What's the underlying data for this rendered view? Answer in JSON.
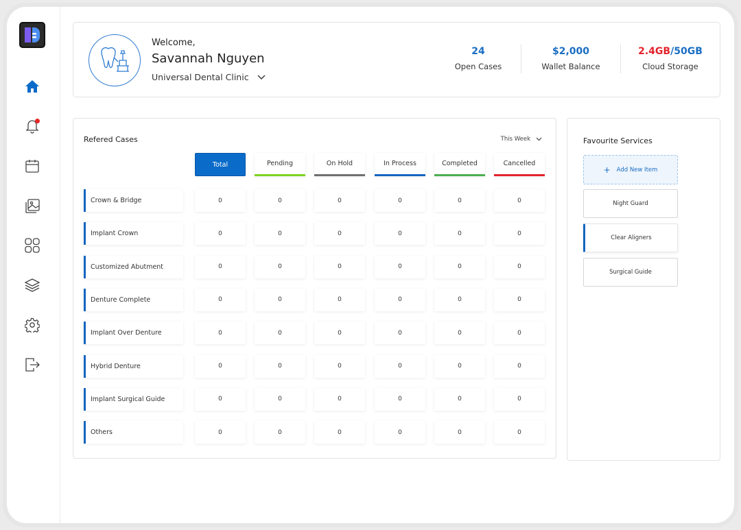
{
  "sidebar": {
    "icons": [
      "home-icon",
      "bell-icon",
      "calendar-icon",
      "gallery-icon",
      "grid-icon",
      "layers-icon",
      "settings-icon",
      "logout-icon"
    ]
  },
  "header": {
    "welcome": "Welcome,",
    "user_name": "Savannah Nguyen",
    "clinic": "Universal Dental Clinic",
    "stats": {
      "open_cases": {
        "value": "24",
        "label": "Open Cases"
      },
      "wallet": {
        "value": "$2,000",
        "label": "Wallet Balance"
      },
      "storage": {
        "used": "2.4GB",
        "separator": "/",
        "total": "50GB",
        "label": "Cloud Storage"
      }
    }
  },
  "cases": {
    "title": "Refered Cases",
    "period": "This Week",
    "tabs": [
      {
        "label": "Total",
        "color": "#0b6bc9"
      },
      {
        "label": "Pending",
        "color": "#7ed321"
      },
      {
        "label": "On Hold",
        "color": "#707070"
      },
      {
        "label": "In Process",
        "color": "#1565c0"
      },
      {
        "label": "Completed",
        "color": "#4caf50"
      },
      {
        "label": "Cancelled",
        "color": "#e3232c"
      }
    ],
    "rows": [
      {
        "label": "Crown & Bridge",
        "values": [
          "0",
          "0",
          "0",
          "0",
          "0",
          "0"
        ]
      },
      {
        "label": "Implant Crown",
        "values": [
          "0",
          "0",
          "0",
          "0",
          "0",
          "0"
        ]
      },
      {
        "label": "Customized Abutment",
        "values": [
          "0",
          "0",
          "0",
          "0",
          "0",
          "0"
        ]
      },
      {
        "label": "Denture Complete",
        "values": [
          "0",
          "0",
          "0",
          "0",
          "0",
          "0"
        ]
      },
      {
        "label": "Implant Over Denture",
        "values": [
          "0",
          "0",
          "0",
          "0",
          "0",
          "0"
        ]
      },
      {
        "label": "Hybrid Denture",
        "values": [
          "0",
          "0",
          "0",
          "0",
          "0",
          "0"
        ]
      },
      {
        "label": "Implant Surgical Guide",
        "values": [
          "0",
          "0",
          "0",
          "0",
          "0",
          "0"
        ]
      },
      {
        "label": "Others",
        "values": [
          "0",
          "0",
          "0",
          "0",
          "0",
          "0"
        ]
      }
    ]
  },
  "favourites": {
    "title": "Favourite Services",
    "add_label": "Add New Item",
    "items": [
      "Night Guard",
      "Clear Aligners",
      "Surgical Guide"
    ]
  }
}
